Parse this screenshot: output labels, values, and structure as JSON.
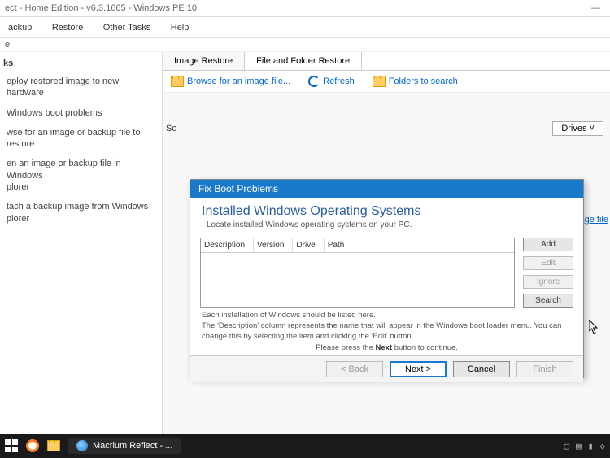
{
  "window": {
    "title": "ect - Home Edition - v6.3.1665 - Windows PE 10",
    "menu": {
      "backup": "ackup",
      "restore": "Restore",
      "other": "Other Tasks",
      "help": "Help"
    },
    "sub_e": "e"
  },
  "sidebar": {
    "header": "ks",
    "items": [
      "eploy restored image to new hardware",
      "Windows boot problems",
      "wse for an image or backup file to restore",
      "en an image or backup file in Windows\nplorer",
      "tach a backup image from Windows\nplorer"
    ]
  },
  "main": {
    "tabs": {
      "image": "Image Restore",
      "file": "File and Folder Restore"
    },
    "toolbar": {
      "browse": "Browse for an image file...",
      "refresh": "Refresh",
      "folders": "Folders to search"
    },
    "so_label": "So",
    "drives": "Drives",
    "image_file_link": "r an image file"
  },
  "wizard": {
    "titlebar": "Fix Boot Problems",
    "heading": "Installed Windows Operating Systems",
    "subhead": "Locate installed Windows operating systems on your PC.",
    "columns": {
      "description": "Description",
      "version": "Version",
      "drive": "Drive",
      "path": "Path"
    },
    "side_buttons": {
      "add": "Add",
      "edit": "Edit",
      "ignore": "Ignore",
      "search": "Search"
    },
    "note1": "Each installation of Windows should be listed here.",
    "note2": "The 'Description' column represents the name that will appear in the Windows boot loader menu. You can change this by selecting the item and clicking the 'Edit' button.",
    "note3_pre": "Please press the ",
    "note3_bold": "Next",
    "note3_post": " button to continue.",
    "footer": {
      "back": "< Back",
      "next": "Next >",
      "cancel": "Cancel",
      "finish": "Finish"
    }
  },
  "taskbar": {
    "app": "Macrium Reflect - ..."
  }
}
